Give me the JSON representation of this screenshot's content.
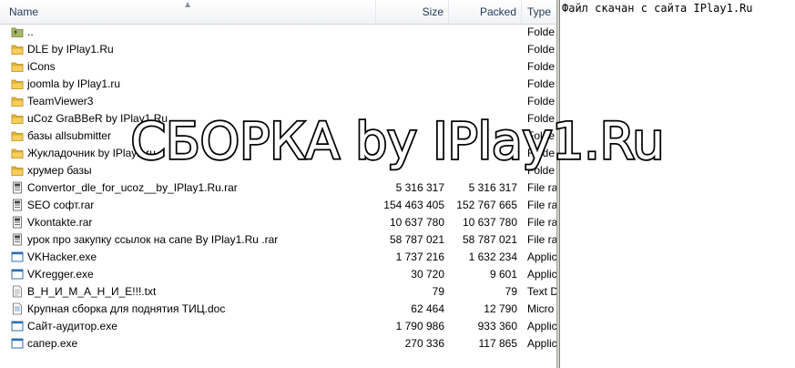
{
  "columns": {
    "name": "Name",
    "size": "Size",
    "packed": "Packed",
    "type": "Type"
  },
  "rows": [
    {
      "kind": "up",
      "name": "..",
      "size": "",
      "packed": "",
      "type": "Folde"
    },
    {
      "kind": "folder",
      "name": "DLE by IPlay1.Ru",
      "size": "",
      "packed": "",
      "type": "Folde"
    },
    {
      "kind": "folder",
      "name": "iCons",
      "size": "",
      "packed": "",
      "type": "Folde"
    },
    {
      "kind": "folder",
      "name": "joomla by IPlay1.ru",
      "size": "",
      "packed": "",
      "type": "Folde"
    },
    {
      "kind": "folder",
      "name": "TeamViewer3",
      "size": "",
      "packed": "",
      "type": "Folde"
    },
    {
      "kind": "folder",
      "name": "uCoz GraBBeR by IPlay1.Ru",
      "size": "",
      "packed": "",
      "type": "Folde"
    },
    {
      "kind": "folder",
      "name": "базы allsubmitter",
      "size": "",
      "packed": "",
      "type": "Folde"
    },
    {
      "kind": "folder",
      "name": "Жукладочник by IPlay1.ru",
      "size": "",
      "packed": "",
      "type": "Folde"
    },
    {
      "kind": "folder",
      "name": "хрумер базы",
      "size": "",
      "packed": "",
      "type": "Folde"
    },
    {
      "kind": "rar",
      "name": "Convertor_dle_for_ucoz__by_IPlay1.Ru.rar",
      "size": "5 316 317",
      "packed": "5 316 317",
      "type": "File ra"
    },
    {
      "kind": "rar",
      "name": "SEO софт.rar",
      "size": "154 463 405",
      "packed": "152 767 665",
      "type": "File ra"
    },
    {
      "kind": "rar",
      "name": "Vkontakte.rar",
      "size": "10 637 780",
      "packed": "10 637 780",
      "type": "File ra"
    },
    {
      "kind": "rar",
      "name": "урок про закупку ссылок на сапе By IPlay1.Ru .rar",
      "size": "58 787 021",
      "packed": "58 787 021",
      "type": "File ra"
    },
    {
      "kind": "exe",
      "name": "VKHacker.exe",
      "size": "1 737 216",
      "packed": "1 632 234",
      "type": "Applic"
    },
    {
      "kind": "exe",
      "name": "VKregger.exe",
      "size": "30 720",
      "packed": "9 601",
      "type": "Applic"
    },
    {
      "kind": "txt",
      "name": "В_Н_И_М_А_Н_И_Е!!!.txt",
      "size": "79",
      "packed": "79",
      "type": "Text D"
    },
    {
      "kind": "doc",
      "name": "Крупная сборка для поднятия ТИЦ.doc",
      "size": "62 464",
      "packed": "12 790",
      "type": "Micro"
    },
    {
      "kind": "exe",
      "name": "Сайт-аудитор.exe",
      "size": "1 790 986",
      "packed": "933 360",
      "type": "Applic"
    },
    {
      "kind": "exe",
      "name": "сапер.exe",
      "size": "270 336",
      "packed": "117 865",
      "type": "Applic"
    }
  ],
  "viewer": {
    "text": "Файл скачан с сайта IPlay1.Ru"
  },
  "overlay": {
    "text": "СБОРКА by IPlay1.Ru"
  },
  "colors": {
    "folder": "#e8b83a",
    "header_text": "#1e395b",
    "exe_blue": "#2c6fb7"
  }
}
